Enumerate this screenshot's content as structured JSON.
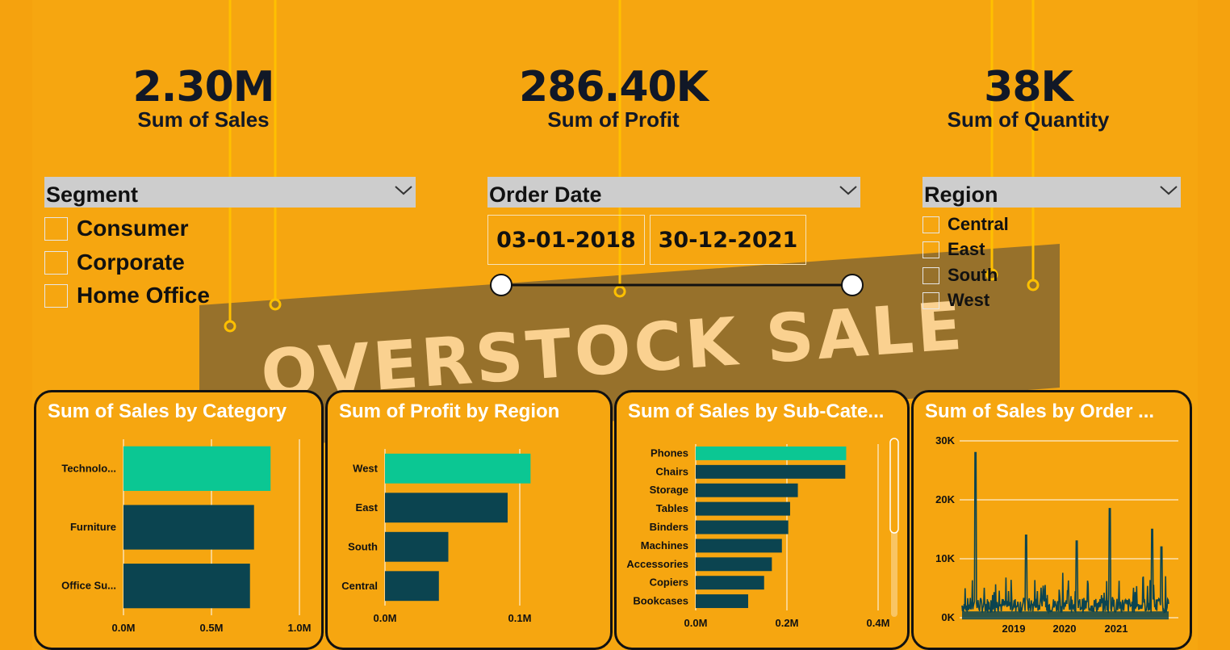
{
  "colors": {
    "background": "#F6A610",
    "highlight_bar": "#0BC793",
    "bar": "#0B4450",
    "banner": "#8A6A2F",
    "banner_text": "#FAD190",
    "ornament": "#FFC000"
  },
  "banner": {
    "text": "OVERSTOCK SALE"
  },
  "kpis": [
    {
      "value": "2.30M",
      "label": "Sum of Sales"
    },
    {
      "value": "286.40K",
      "label": "Sum of Profit"
    },
    {
      "value": "38K",
      "label": "Sum of Quantity"
    }
  ],
  "segment_slicer": {
    "title": "Segment",
    "options": [
      "Consumer",
      "Corporate",
      "Home Office"
    ]
  },
  "date_slicer": {
    "title": "Order Date",
    "start": "03-01-2018",
    "end": "30-12-2021"
  },
  "region_slicer": {
    "title": "Region",
    "options": [
      "Central",
      "East",
      "South",
      "West"
    ]
  },
  "chart_data": [
    {
      "type": "bar",
      "title": "Sum of Sales by Category",
      "orientation": "horizontal",
      "categories": [
        "Technolo...",
        "Furniture",
        "Office Su..."
      ],
      "values": [
        0.836,
        0.742,
        0.719
      ],
      "unit": "M",
      "xlim": [
        0,
        1.0
      ],
      "xticks": [
        "0.0M",
        "0.5M",
        "1.0M"
      ],
      "highlight_index": 0
    },
    {
      "type": "bar",
      "title": "Sum of Profit by Region",
      "orientation": "horizontal",
      "categories": [
        "West",
        "East",
        "South",
        "Central"
      ],
      "values": [
        0.108,
        0.091,
        0.047,
        0.04
      ],
      "unit": "M",
      "xlim": [
        0,
        0.1
      ],
      "xticks": [
        "0.0M",
        "0.1M"
      ],
      "highlight_index": 0
    },
    {
      "type": "bar",
      "title": "Sum of Sales by Sub-Cate...",
      "orientation": "horizontal",
      "categories": [
        "Phones",
        "Chairs",
        "Storage",
        "Tables",
        "Binders",
        "Machines",
        "Accessories",
        "Copiers",
        "Bookcases"
      ],
      "values": [
        0.33,
        0.328,
        0.224,
        0.207,
        0.203,
        0.189,
        0.167,
        0.15,
        0.115
      ],
      "unit": "M",
      "xlim": [
        0,
        0.4
      ],
      "xticks": [
        "0.0M",
        "0.2M",
        "0.4M"
      ],
      "highlight_index": 0
    },
    {
      "type": "line",
      "title": "Sum of Sales by Order ...",
      "x_labels": [
        "2019",
        "2020",
        "2021"
      ],
      "y_ticks": [
        "0K",
        "10K",
        "20K",
        "30K"
      ],
      "ylim": [
        0,
        30000
      ],
      "x_range": [
        "2018-01-03",
        "2021-12-30"
      ],
      "peaks": [
        {
          "x": 0.065,
          "y": 28000
        },
        {
          "x": 0.31,
          "y": 14000
        },
        {
          "x": 0.555,
          "y": 13000
        },
        {
          "x": 0.715,
          "y": 18500
        },
        {
          "x": 0.92,
          "y": 15000
        },
        {
          "x": 0.965,
          "y": 12000
        }
      ]
    }
  ]
}
